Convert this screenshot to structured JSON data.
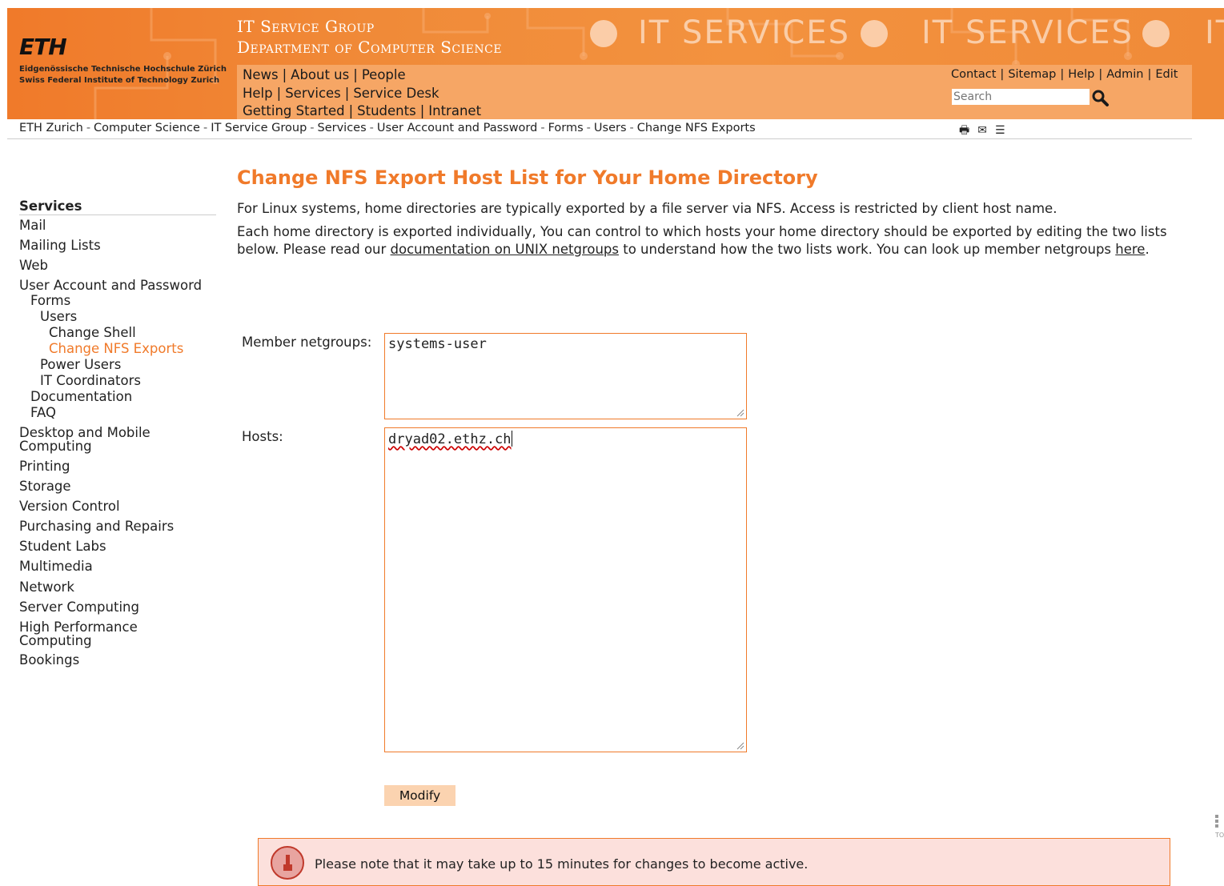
{
  "header": {
    "logo": "ETH",
    "logo_sub": "Eidgenössische Technische Hochschule Zürich\nSwiss Federal Institute of Technology Zurich",
    "group_line1": "IT Service Group",
    "group_line2": "Department of Computer Science",
    "brand": "IT SERVICES",
    "brand_cut": "IT",
    "nav_rows": [
      [
        "News",
        "About us",
        "People"
      ],
      [
        "Help",
        "Services",
        "Service Desk"
      ],
      [
        "Getting Started",
        "Students",
        "Intranet"
      ]
    ],
    "util_links": [
      "Contact",
      "Sitemap",
      "Help",
      "Admin",
      "Edit"
    ],
    "search_placeholder": "Search",
    "search_icon": "magnifier-icon",
    "colors": {
      "orange": "#f07a2a",
      "panel": "#f6a665",
      "note_bg": "#fce0dc"
    }
  },
  "breadcrumb": [
    "ETH Zurich",
    "Computer Science",
    "IT Service Group",
    "Services",
    "User Account and Password",
    "Forms",
    "Users",
    "Change NFS Exports"
  ],
  "page_tools": [
    "print-icon",
    "mail-icon",
    "document-icon"
  ],
  "sidebar": {
    "heading": "Services",
    "items": [
      "Mail",
      "Mailing Lists",
      "Web",
      "User Account and Password",
      "Forms",
      "Users",
      "Change Shell",
      "Change NFS Exports",
      "Power Users",
      "IT Coordinators",
      "Documentation",
      "FAQ",
      "Desktop and Mobile Computing",
      "Printing",
      "Storage",
      "Version Control",
      "Purchasing and Repairs",
      "Student Labs",
      "Multimedia",
      "Network",
      "Server Computing",
      "High Performance Computing",
      "Bookings"
    ],
    "active": "Change NFS Exports"
  },
  "main": {
    "title": "Change NFS Export Host List for Your Home Directory",
    "para1": "For Linux systems, home directories are typically exported by a file server via NFS. Access is restricted by client host name.",
    "para2_before": "Each home directory is exported individually, You can control to which hosts your home directory should be exported by editing the two lists below. Please read our ",
    "para2_link": "documentation on UNIX netgroups",
    "para2_mid": " to understand how the two lists work. You can look up member netgroups ",
    "para2_link2": "here",
    "para2_end": ".",
    "member_label": "Member netgroups:",
    "member_value": "systems-user",
    "hosts_label": "Hosts:",
    "hosts_value": "dryad02.ethz.ch",
    "modify_label": "Modify",
    "note": "Please note that it may take up to 15 minutes for changes to become active."
  },
  "side_marker": "TO"
}
